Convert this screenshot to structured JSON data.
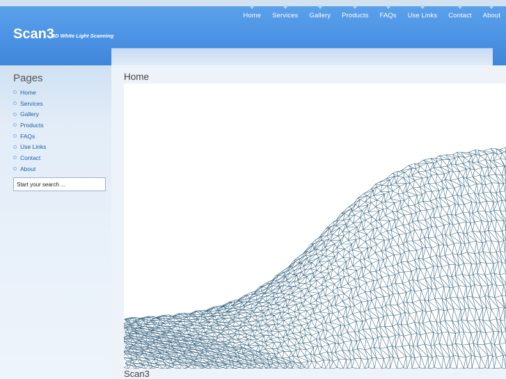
{
  "site": {
    "title": "Scan3",
    "tagline": "3D White Light Scanning"
  },
  "nav": {
    "items": [
      "Home",
      "Services",
      "Gallery",
      "Products",
      "FAQs",
      "Use Links",
      "Contact",
      "About"
    ]
  },
  "sidebar": {
    "heading": "Pages",
    "items": [
      "Home",
      "Services",
      "Gallery",
      "Products",
      "FAQs",
      "Use Links",
      "Contact",
      "About"
    ],
    "search_placeholder": "Start your search ..."
  },
  "main": {
    "title": "Home",
    "caption": "Scan3"
  },
  "colors": {
    "header": "#4a91e3",
    "mesh": "#3f6a85",
    "link": "#1f5fa6"
  }
}
